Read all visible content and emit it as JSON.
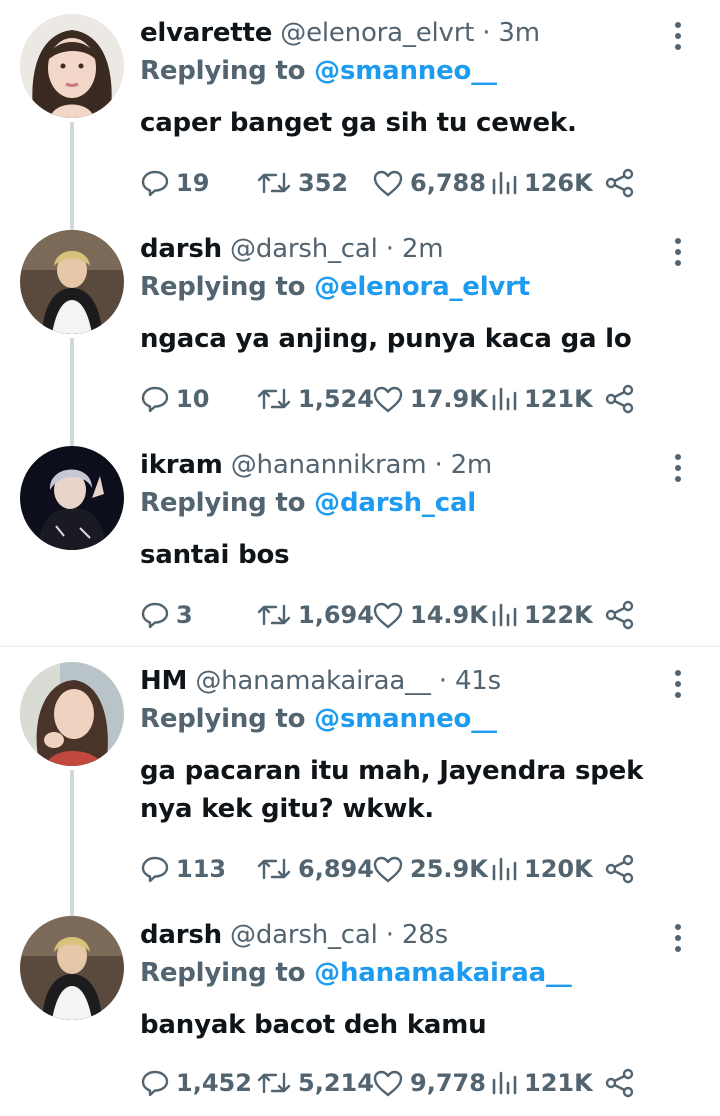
{
  "tweets": [
    {
      "name": "elvarette",
      "handle": "@elenora_elvrt",
      "dot": "·",
      "time": "3m",
      "reply_prefix": "Replying to",
      "reply_to": "@smanneo__",
      "text": "caper banget ga sih tu cewek.",
      "stats": {
        "replies": "19",
        "retweets": "352",
        "likes": "6,788",
        "views": "126K"
      }
    },
    {
      "name": "darsh",
      "handle": "@darsh_cal",
      "dot": "·",
      "time": "2m",
      "reply_prefix": "Replying to",
      "reply_to": "@elenora_elvrt",
      "text": "ngaca ya anjing, punya kaca ga lo",
      "stats": {
        "replies": "10",
        "retweets": "1,524",
        "likes": "17.9K",
        "views": "121K"
      }
    },
    {
      "name": "ikram",
      "handle": "@hanannikram",
      "dot": "·",
      "time": "2m",
      "reply_prefix": "Replying to",
      "reply_to": "@darsh_cal",
      "text": "santai bos",
      "stats": {
        "replies": "3",
        "retweets": "1,694",
        "likes": "14.9K",
        "views": "122K"
      }
    },
    {
      "name": "HM",
      "handle": "@hanamakairaa__",
      "dot": "·",
      "time": "41s",
      "reply_prefix": "Replying to",
      "reply_to": "@smanneo__",
      "text": "ga pacaran itu mah, Jayendra spek nya kek gitu? wkwk.",
      "stats": {
        "replies": "113",
        "retweets": "6,894",
        "likes": "25.9K",
        "views": "120K"
      }
    },
    {
      "name": "darsh",
      "handle": "@darsh_cal",
      "dot": "·",
      "time": "28s",
      "reply_prefix": "Replying to",
      "reply_to": "@hanamakairaa__",
      "text": "banyak bacot deh kamu",
      "stats": {
        "replies": "1,452",
        "retweets": "5,214",
        "likes": "9,778",
        "views": "121K"
      }
    }
  ],
  "colors": {
    "primary_text": "#0f1419",
    "secondary_text": "#536471",
    "mention": "#1d9bf0",
    "thread_line": "#cfd9de"
  },
  "icons": [
    "reply-icon",
    "retweet-icon",
    "like-icon",
    "views-icon",
    "share-icon",
    "more-icon"
  ]
}
